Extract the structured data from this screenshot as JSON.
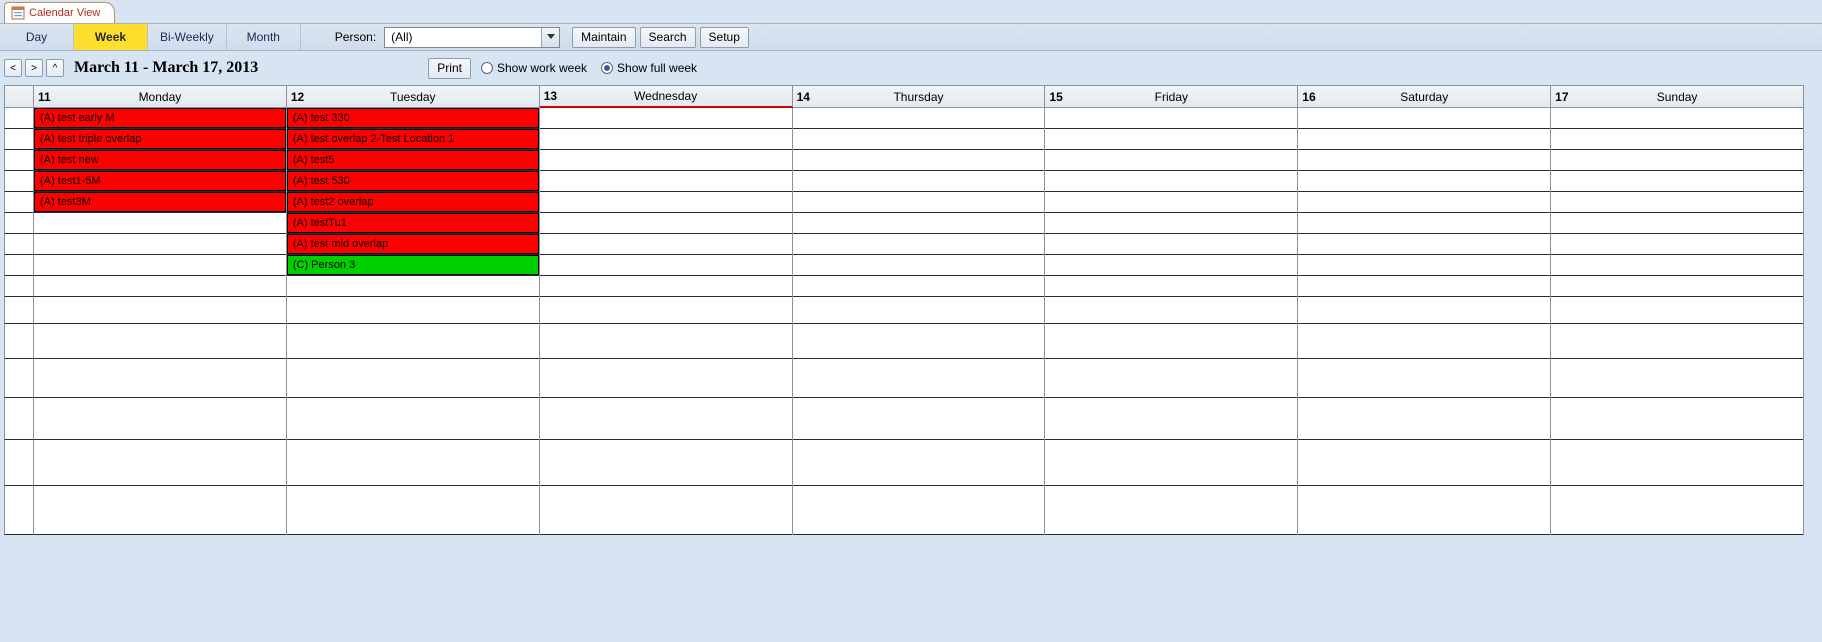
{
  "docTab": {
    "title": "Calendar View"
  },
  "views": {
    "items": [
      {
        "label": "Day",
        "active": false
      },
      {
        "label": "Week",
        "active": true
      },
      {
        "label": "Bi-Weekly",
        "active": false
      },
      {
        "label": "Month",
        "active": false
      }
    ]
  },
  "person": {
    "label": "Person:",
    "value": "(All)"
  },
  "toolbarButtons": {
    "maintain": "Maintain",
    "search": "Search",
    "setup": "Setup"
  },
  "nav": {
    "prev": "<",
    "next": ">",
    "up": "^"
  },
  "rangeLabel": "March 11 - March 17, 2013",
  "printLabel": "Print",
  "weekOptions": {
    "work": "Show work week",
    "full": "Show full week",
    "selected": "full"
  },
  "days": [
    {
      "num": "11",
      "name": "Monday"
    },
    {
      "num": "12",
      "name": "Tuesday"
    },
    {
      "num": "13",
      "name": "Wednesday"
    },
    {
      "num": "14",
      "name": "Thursday"
    },
    {
      "num": "15",
      "name": "Friday"
    },
    {
      "num": "16",
      "name": "Saturday"
    },
    {
      "num": "17",
      "name": "Sunday"
    }
  ],
  "rows": 15,
  "events": {
    "monday": [
      {
        "label": "(A) test early M",
        "color": "red"
      },
      {
        "label": "(A) test triple overlap",
        "color": "red"
      },
      {
        "label": "(A) test new",
        "color": "red"
      },
      {
        "label": "(A) test1-5M",
        "color": "red"
      },
      {
        "label": "(A) test3M",
        "color": "red"
      }
    ],
    "tuesday": [
      {
        "label": "(A) test 330",
        "color": "red"
      },
      {
        "label": "(A) test overlap 2-Test Location 1",
        "color": "red"
      },
      {
        "label": "(A) test5",
        "color": "red"
      },
      {
        "label": "(A) test 530",
        "color": "red"
      },
      {
        "label": "(A) test2 overlap",
        "color": "red"
      },
      {
        "label": "(A) testTu1",
        "color": "red"
      },
      {
        "label": "(A) test mid overlap",
        "color": "red"
      },
      {
        "label": "(C) Person 3",
        "color": "green"
      }
    ]
  }
}
